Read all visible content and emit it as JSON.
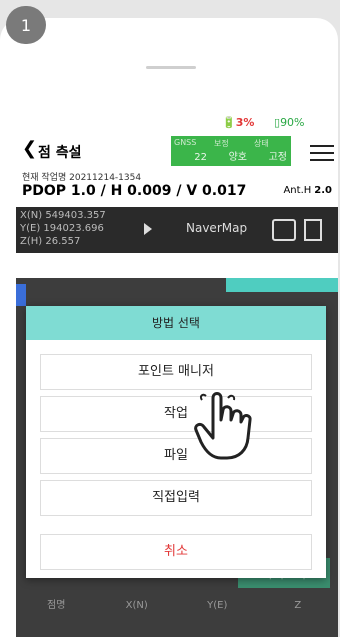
{
  "step_badge": "1",
  "status": {
    "battery_low": "3%",
    "battery_main": "90%"
  },
  "header": {
    "back": "❮",
    "title": "점 측설"
  },
  "gnss": {
    "labels": [
      "GNSS",
      "보정",
      "상태"
    ],
    "values": [
      "22",
      "양호",
      "고정"
    ]
  },
  "work_name": "현재 작업명 20211214-1354",
  "pdop": "PDOP 1.0 / H 0.009 / V 0.017",
  "ant": {
    "label": "Ant.H",
    "value": "2.0"
  },
  "coords": [
    "X(N) 549403.357",
    "Y(E) 194023.696",
    "Z(H) 26.557"
  ],
  "map_button": "NaverMap",
  "dialog": {
    "title": "방법 선택",
    "options": [
      "포인트 매니저",
      "작업",
      "파일",
      "직접입력"
    ],
    "cancel": "취소"
  },
  "fetch_button": "가져오기",
  "table": {
    "headers": [
      "점명",
      "X(N)",
      "Y(E)",
      "Z"
    ]
  }
}
